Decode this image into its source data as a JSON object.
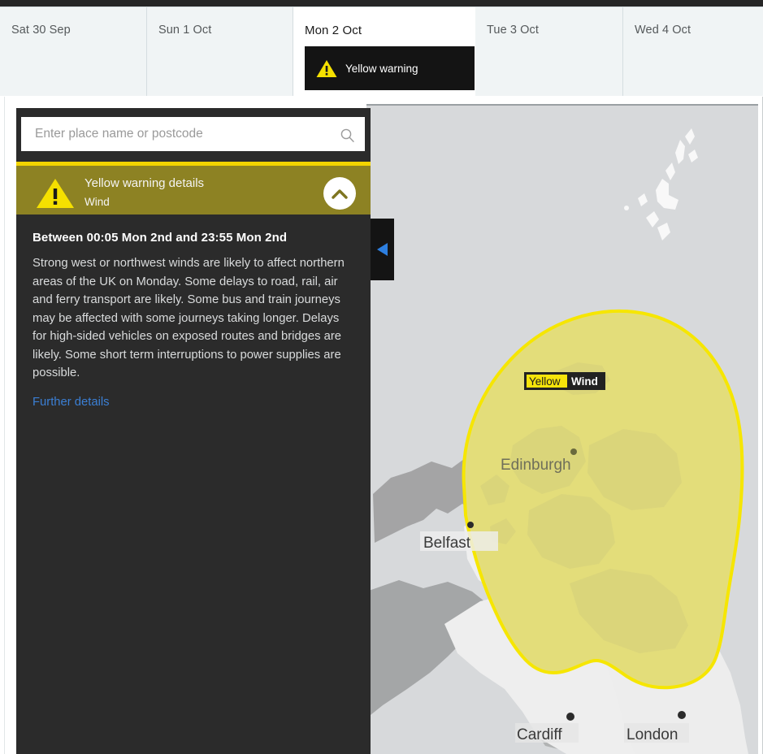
{
  "app": {
    "accent_yellow": "#f3d400",
    "warning_olive": "#8d8223",
    "panel_dark": "#2b2b2b",
    "link_blue": "#3b7fd4"
  },
  "tabbar": {
    "days": [
      {
        "label": "Sat 30 Sep",
        "active": false,
        "warning": null
      },
      {
        "label": "Sun 1 Oct",
        "active": false,
        "warning": null
      },
      {
        "label": "Mon 2 Oct",
        "active": true,
        "warning": "Yellow warning"
      },
      {
        "label": "Tue 3 Oct",
        "active": false,
        "warning": null
      },
      {
        "label": "Wed 4 Oct",
        "active": false,
        "warning": null
      }
    ]
  },
  "search": {
    "placeholder": "Enter place name or postcode",
    "value": "",
    "icon": "search-icon"
  },
  "collapse_panel": {
    "icon": "triangle-left-icon",
    "label": "Collapse panel"
  },
  "warning": {
    "header_title": "Yellow warning details",
    "header_subtitle": "Wind",
    "header_icon": "warning-triangle-icon",
    "collapse_icon": "chevron-up-icon",
    "period": "Between 00:05 Mon 2nd and 23:55 Mon 2nd",
    "description": "Strong west or northwest winds are likely to affect northern areas of the UK on Monday. Some delays to road, rail, air and ferry transport are likely. Some bus and train journeys may be affected with some journeys taking longer. Delays for high-sided vehicles on exposed routes and bridges are likely. Some short term interruptions to power supplies are possible.",
    "further_details_label": "Further details"
  },
  "map": {
    "area_badge": {
      "level": "Yellow",
      "hazard": "Wind"
    },
    "cities": [
      {
        "name": "Edinburgh"
      },
      {
        "name": "Belfast"
      },
      {
        "name": "Cardiff"
      },
      {
        "name": "London"
      }
    ],
    "colors": {
      "sea": "#d7d9db",
      "land": "#ededed",
      "land_outside": "#a8a8a8",
      "warning_fill": "#e3dd7a",
      "warning_stroke": "#f6e600"
    }
  }
}
